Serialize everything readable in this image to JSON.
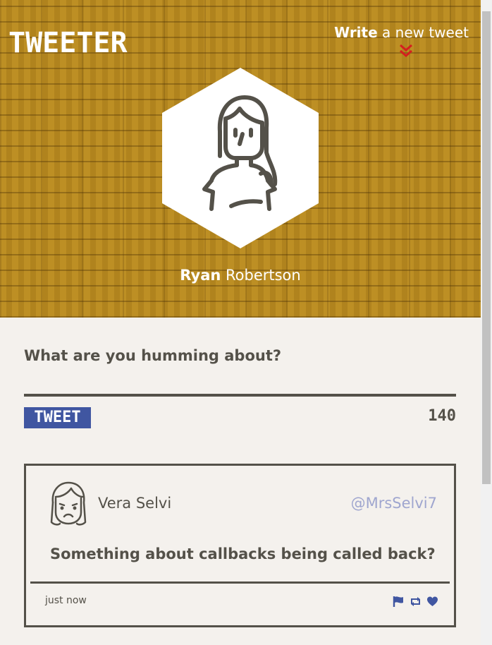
{
  "header": {
    "brand": "TWEETER",
    "compose_link_strong": "Write",
    "compose_link_rest": " a new tweet",
    "chevron_icon": "double-chevron-down-icon",
    "chevron_color": "#d41f1f"
  },
  "profile": {
    "first_name": "Ryan",
    "last_name": " Robertson",
    "avatar_icon": "woman-avatar-icon"
  },
  "composer": {
    "prompt": "What are you humming about?",
    "button_label": "TWEET",
    "char_count": "140"
  },
  "tweet": {
    "avatar_icon": "sad-face-avatar-icon",
    "name": "Vera Selvi",
    "handle": "@MrsSelvi7",
    "body": "Something about callbacks being called back?",
    "time": "just now",
    "actions": [
      "flag-icon",
      "retweet-icon",
      "heart-icon"
    ]
  },
  "colors": {
    "accent_blue": "#4056a1",
    "text_dark": "#545149",
    "handle": "#9fa6cf",
    "background": "#f4f1ed",
    "brick": "#b98a1f"
  }
}
